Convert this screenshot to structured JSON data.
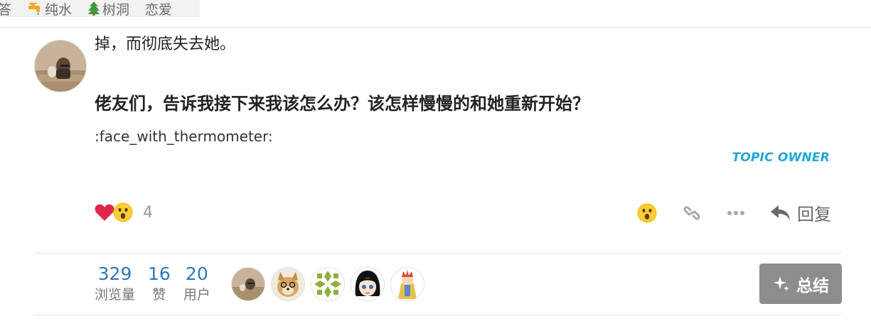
{
  "tags": [
    {
      "label": "答",
      "icon": "none"
    },
    {
      "label": "纯水",
      "icon": "water-tap-icon"
    },
    {
      "label": "树洞",
      "icon": "evergreen-tree-icon"
    },
    {
      "label": "恋爱",
      "icon": "none"
    }
  ],
  "post": {
    "line1": "掉，而彻底失去她。",
    "heading": "佬友们，告诉我接下来我该怎么办？该怎样慢慢的和她重新开始？",
    "emoji_code": ":face_with_thermometer:",
    "owner_badge": "TOPIC OWNER"
  },
  "reactions": {
    "icons": [
      "heart-icon",
      "surprised-face-icon"
    ],
    "count": "4"
  },
  "actions": {
    "reply_label": "回复"
  },
  "stats": [
    {
      "value": "329",
      "label": "浏览量"
    },
    {
      "value": "16",
      "label": "赞"
    },
    {
      "value": "20",
      "label": "用户"
    }
  ],
  "summary": {
    "label": "总结"
  },
  "colors": {
    "link_blue": "#2e78b7",
    "owner_blue": "#22a7d6",
    "heart_red": "#e0274a",
    "emoji_yellow": "#ffcc33",
    "button_gray": "#8d8d8d"
  }
}
